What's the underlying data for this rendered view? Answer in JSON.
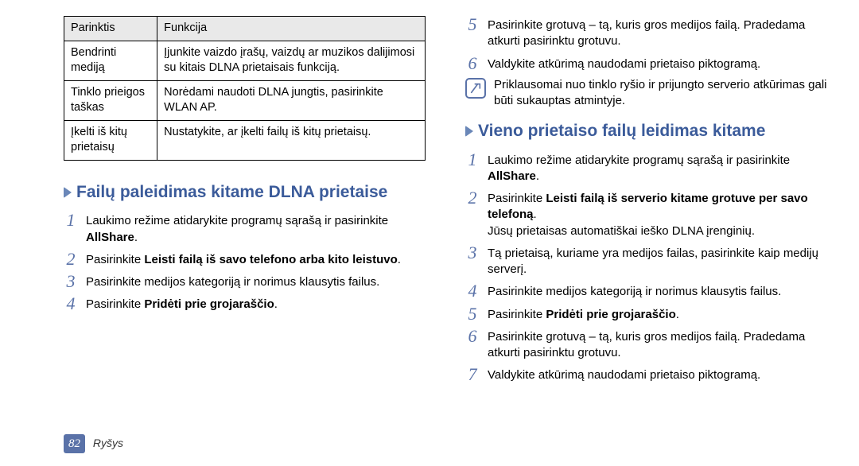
{
  "table": {
    "header": {
      "col1": "Parinktis",
      "col2": "Funkcija"
    },
    "rows": [
      {
        "opt": "Bendrinti mediją",
        "desc": "Įjunkite vaizdo įrašų, vaizdų ar muzikos dalijimosi su kitais DLNA prietaisais funkciją."
      },
      {
        "opt": "Tinklo prieigos taškas",
        "desc": "Norėdami naudoti DLNA jungtis, pasirinkite WLAN AP."
      },
      {
        "opt": "Įkelti iš kitų prietaisų",
        "desc": "Nustatykite, ar įkelti failų iš kitų prietaisų."
      }
    ]
  },
  "left_section": {
    "title": "Failų paleidimas kitame DLNA prietaise",
    "steps": [
      {
        "n": "1",
        "pre": "Laukimo režime atidarykite programų sąrašą ir pasirinkite ",
        "b": "AllShare",
        "post": "."
      },
      {
        "n": "2",
        "pre": "Pasirinkite ",
        "b": "Leisti failą iš savo telefono arba kito leistuvo",
        "post": "."
      },
      {
        "n": "3",
        "pre": "Pasirinkite medijos kategoriją ir norimus klausytis failus.",
        "b": "",
        "post": ""
      },
      {
        "n": "4",
        "pre": "Pasirinkite ",
        "b": "Pridėti prie grojaraščio",
        "post": "."
      }
    ]
  },
  "right_top_steps": [
    {
      "n": "5",
      "pre": "Pasirinkite grotuvą – tą, kuris gros medijos failą. Pradedama atkurti pasirinktu grotuvu.",
      "b": "",
      "post": ""
    },
    {
      "n": "6",
      "pre": "Valdykite atkūrimą naudodami prietaiso piktogramą.",
      "b": "",
      "post": ""
    }
  ],
  "note_text": "Priklausomai nuo tinklo ryšio ir prijungto serverio atkūrimas gali būti sukauptas atmintyje.",
  "right_section": {
    "title": "Vieno prietaiso failų leidimas kitame",
    "steps": [
      {
        "n": "1",
        "pre": "Laukimo režime atidarykite programų sąrašą ir pasirinkite ",
        "b": "AllShare",
        "post": "."
      },
      {
        "n": "2",
        "pre": "Pasirinkite ",
        "b": "Leisti failą iš serverio kitame grotuve per savo telefoną",
        "post": ".",
        "extra": "Jūsų prietaisas automatiškai ieško DLNA įrenginių."
      },
      {
        "n": "3",
        "pre": "Tą prietaisą, kuriame yra medijos failas, pasirinkite kaip medijų serverį.",
        "b": "",
        "post": ""
      },
      {
        "n": "4",
        "pre": "Pasirinkite medijos kategoriją ir norimus klausytis failus.",
        "b": "",
        "post": ""
      },
      {
        "n": "5",
        "pre": "Pasirinkite ",
        "b": "Pridėti prie grojaraščio",
        "post": "."
      },
      {
        "n": "6",
        "pre": "Pasirinkite grotuvą – tą, kuris gros medijos failą. Pradedama atkurti pasirinktu grotuvu.",
        "b": "",
        "post": ""
      },
      {
        "n": "7",
        "pre": "Valdykite atkūrimą naudodami prietaiso piktogramą.",
        "b": "",
        "post": ""
      }
    ]
  },
  "footer": {
    "page": "82",
    "section": "Ryšys"
  }
}
